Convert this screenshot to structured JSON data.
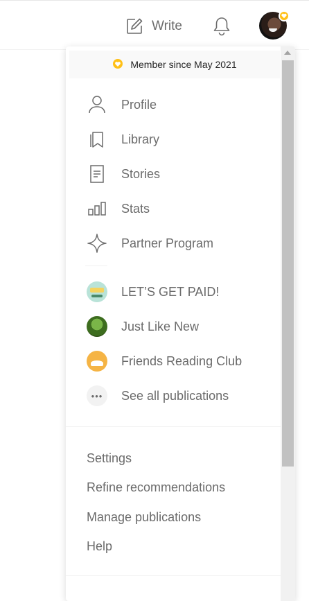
{
  "header": {
    "write_label": "Write",
    "write_icon": "write-icon",
    "bell_icon": "bell-icon",
    "avatar_badge_color": "#ffc017"
  },
  "menu": {
    "member_since": "Member since May 2021",
    "items": [
      {
        "label": "Profile",
        "icon": "user-icon"
      },
      {
        "label": "Library",
        "icon": "bookmark-icon"
      },
      {
        "label": "Stories",
        "icon": "document-icon"
      },
      {
        "label": "Stats",
        "icon": "bar-chart-icon"
      },
      {
        "label": "Partner Program",
        "icon": "sparkle-icon"
      }
    ],
    "publications": [
      {
        "label": "LET’S GET PAID!"
      },
      {
        "label": "Just Like New"
      },
      {
        "label": "Friends Reading Club"
      },
      {
        "label": "See all publications",
        "icon_text": "•••"
      }
    ],
    "links": [
      {
        "label": "Settings"
      },
      {
        "label": "Refine recommendations"
      },
      {
        "label": "Manage publications"
      },
      {
        "label": "Help"
      }
    ]
  },
  "colors": {
    "accent": "#ffc017",
    "text_muted": "#6b6b6b",
    "text_dark": "#242424"
  }
}
